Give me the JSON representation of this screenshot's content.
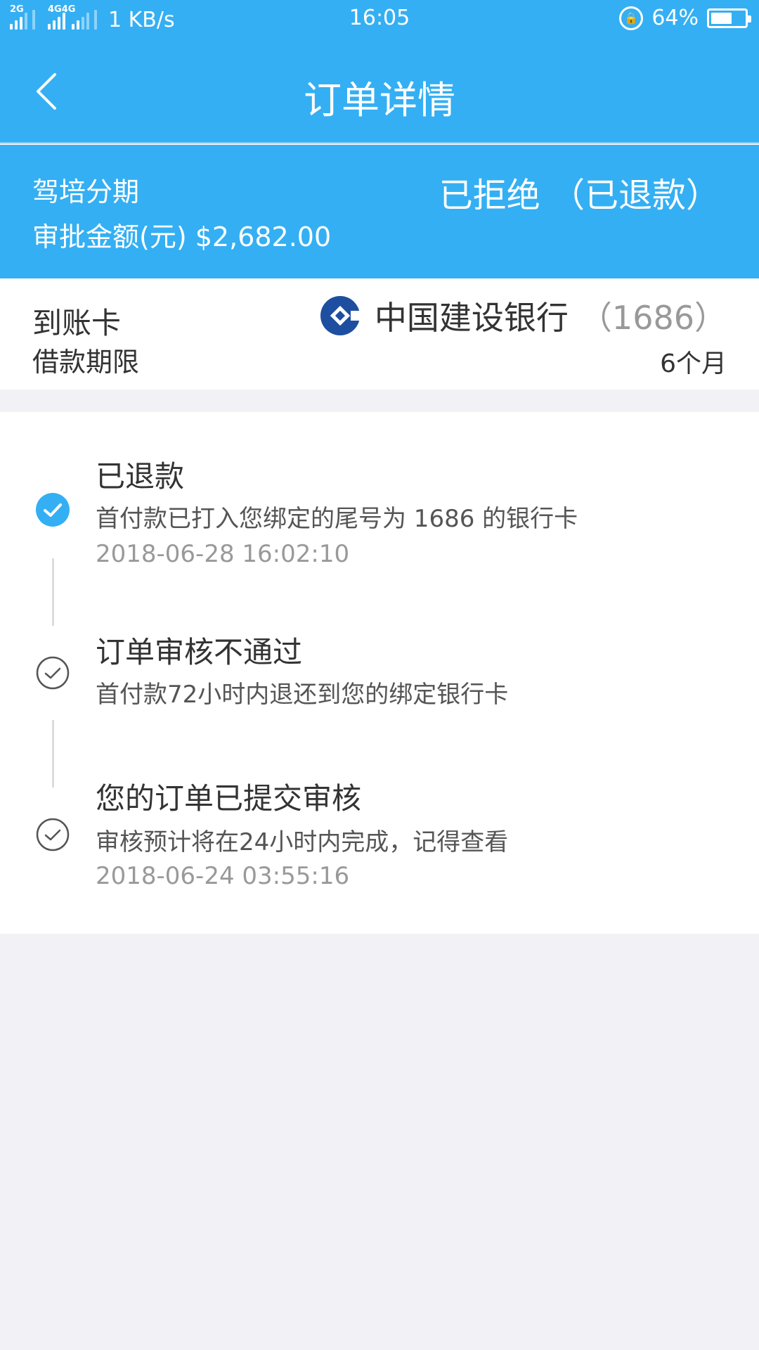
{
  "status_bar": {
    "sim1": "2G",
    "sim2": "4G",
    "sim2b": "4G",
    "speed": "1 KB/s",
    "time": "16:05",
    "battery": "64%",
    "battery_level": 0.64
  },
  "nav": {
    "title": "订单详情"
  },
  "summary": {
    "product": "驾培分期",
    "amount_label": "审批金额(元) $2,682.00",
    "status": "已拒绝 （已退款）"
  },
  "card_info": {
    "card_label": "到账卡",
    "term_label": "借款期限",
    "bank_name": "中国建设银行",
    "card_tail": "（1686）",
    "term_value": "6个月"
  },
  "timeline": [
    {
      "title": "已退款",
      "desc": "首付款已打入您绑定的尾号为 1686 的银行卡",
      "time": "2018-06-28 16:02:10",
      "state": "active"
    },
    {
      "title": "订单审核不通过",
      "desc": "首付款72小时内退还到您的绑定银行卡",
      "time": "",
      "state": "done"
    },
    {
      "title": "您的订单已提交审核",
      "desc": "审核预计将在24小时内完成，记得查看",
      "time": "2018-06-24 03:55:16",
      "state": "done"
    }
  ],
  "colors": {
    "primary": "#34aff3",
    "bank_logo": "#1e4ea0",
    "background": "#f2f2f6"
  }
}
